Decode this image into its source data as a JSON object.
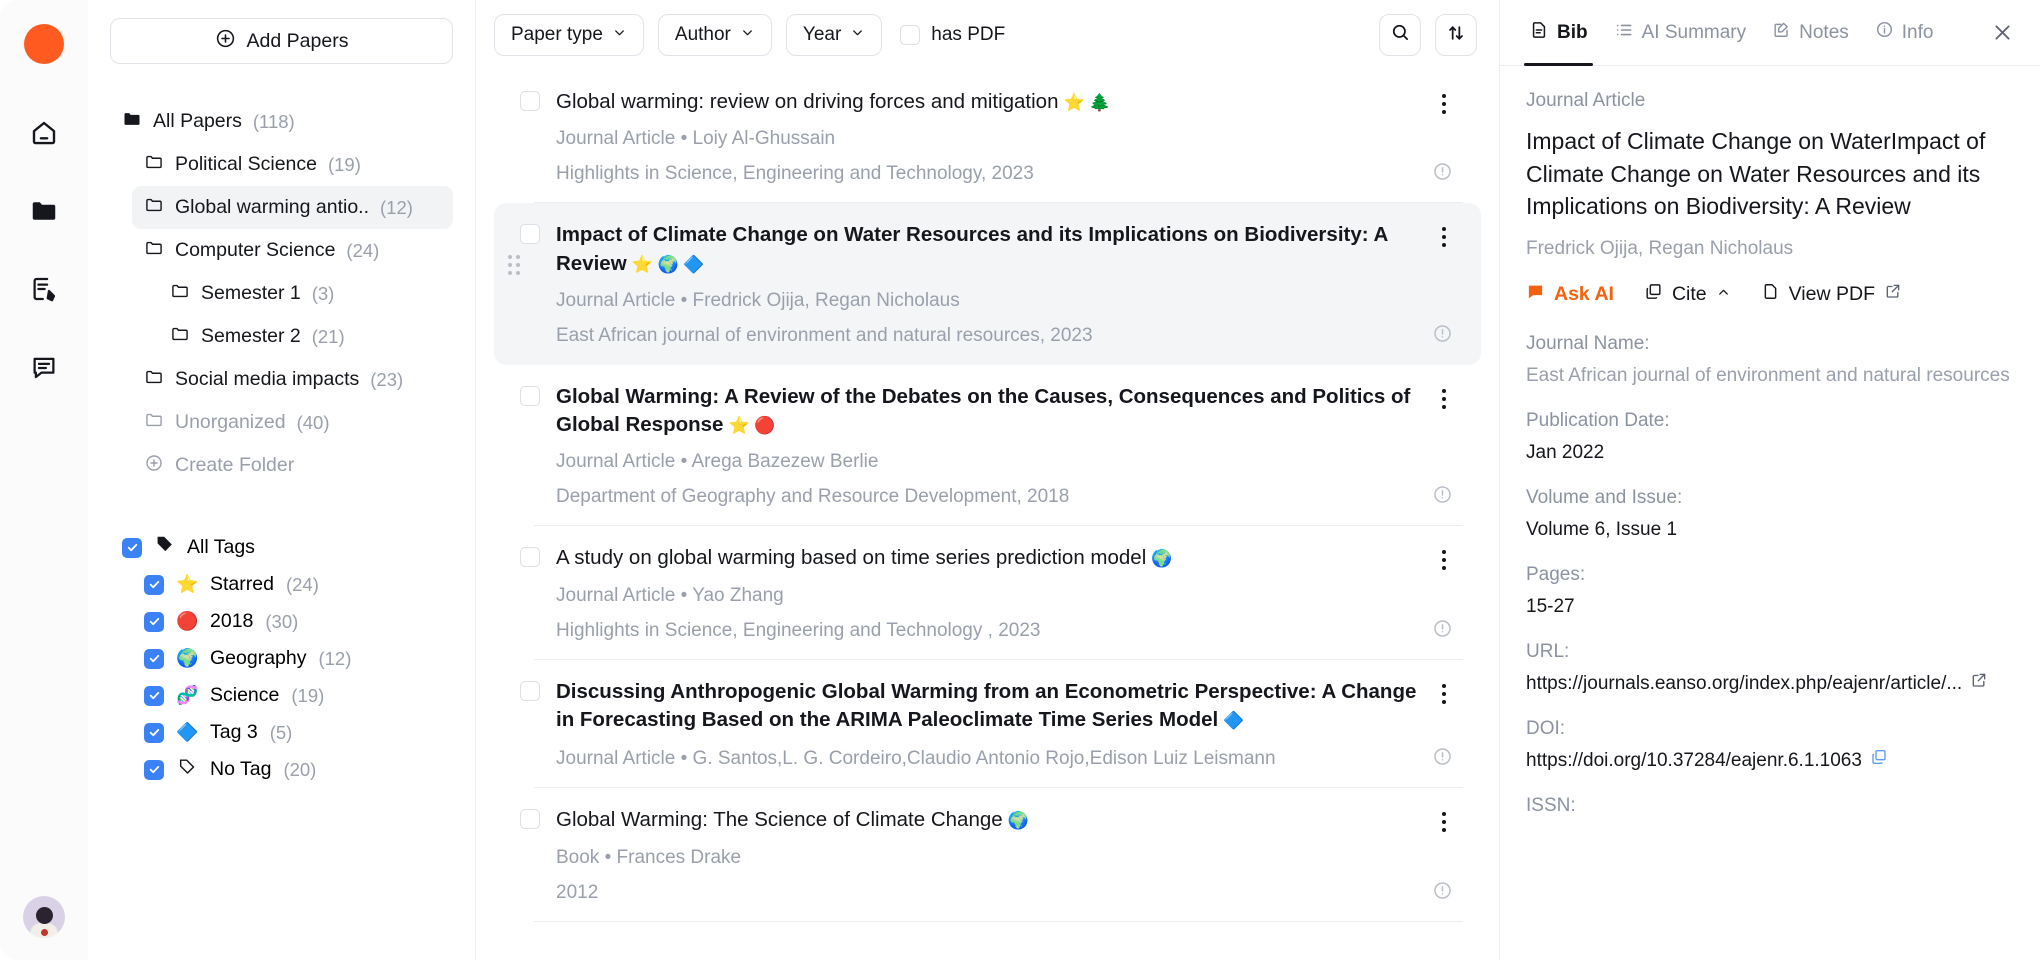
{
  "rail": {
    "logo": "logo-dot",
    "icons": [
      "home-icon",
      "folder-icon",
      "notes-icon",
      "chat-icon"
    ],
    "avatar": "user-avatar"
  },
  "sidebar": {
    "add_papers_label": "Add Papers",
    "folders": [
      {
        "label": "All Papers",
        "count": "(118)",
        "indent": 0,
        "active": false,
        "filled": true
      },
      {
        "label": "Political Science",
        "count": "(19)",
        "indent": 1,
        "active": false,
        "filled": false
      },
      {
        "label": "Global warming antio..",
        "count": "(12)",
        "indent": 1,
        "active": true,
        "filled": false
      },
      {
        "label": "Computer Science",
        "count": "(24)",
        "indent": 1,
        "active": false,
        "filled": false
      },
      {
        "label": "Semester 1",
        "count": "(3)",
        "indent": 2,
        "active": false,
        "filled": false
      },
      {
        "label": "Semester 2",
        "count": "(21)",
        "indent": 2,
        "active": false,
        "filled": false
      },
      {
        "label": "Social media impacts",
        "count": "(23)",
        "indent": 1,
        "active": false,
        "filled": false
      },
      {
        "label": "Unorganized",
        "count": "(40)",
        "indent": 1,
        "active": false,
        "filled": false
      }
    ],
    "create_folder_label": "Create Folder",
    "all_tags_label": "All Tags",
    "tags": [
      {
        "emoji": "⭐",
        "label": "Starred",
        "count": "(24)",
        "checked": true
      },
      {
        "emoji": "🔴",
        "label": "2018",
        "count": "(30)",
        "checked": true
      },
      {
        "emoji": "🌍",
        "label": "Geography",
        "count": "(12)",
        "checked": true
      },
      {
        "emoji": "🧬",
        "label": "Science",
        "count": "(19)",
        "checked": true
      },
      {
        "emoji": "🔷",
        "label": "Tag 3",
        "count": "(5)",
        "checked": true
      },
      {
        "emoji": "🏷️",
        "label": "No Tag",
        "count": "(20)",
        "checked": true
      }
    ]
  },
  "toolbar": {
    "filters": [
      {
        "label": "Paper type",
        "icon": "chevron-down-icon"
      },
      {
        "label": "Author",
        "icon": "chevron-down-icon"
      },
      {
        "label": "Year",
        "icon": "chevron-down-icon"
      }
    ],
    "has_pdf_label": "has PDF",
    "has_pdf_checked": false,
    "search_icon": "search-icon",
    "sort_icon": "sort-icon"
  },
  "papers": [
    {
      "title": "Global warming: review on driving forces and mitigation",
      "tags": "⭐ 🌲",
      "meta": "Journal Article • Loiy Al-Ghussain",
      "source": "Highlights in Science, Engineering and Technology, 2023",
      "selected": false,
      "bold": false
    },
    {
      "title": "Impact of Climate Change on Water Resources and its Implications on Biodiversity: A Review",
      "tags": "⭐ 🌍 🔷",
      "meta": "Journal Article • Fredrick Ojija, Regan Nicholaus",
      "source": "East African journal of environment and natural resources, 2023",
      "selected": true,
      "bold": true
    },
    {
      "title": "Global Warming: A Review of the Debates on the Causes, Consequences and Politics of Global Response",
      "tags": "⭐ 🔴",
      "meta": "Journal Article • Arega Bazezew Berlie",
      "source": "Department of Geography and Resource Development, 2018",
      "selected": false,
      "bold": true
    },
    {
      "title": "A study on global warming based on time series prediction model",
      "tags": "🌍",
      "meta": "Journal Article • Yao Zhang",
      "source": "Highlights in Science, Engineering and Technology , 2023",
      "selected": false,
      "bold": false
    },
    {
      "title": "Discussing Anthropogenic Global Warming from an Econometric Perspective: A Change in Forecasting Based on the ARIMA Paleoclimate Time Series Model",
      "tags": "🔷",
      "meta": "Journal Article • G. Santos,L. G. Cordeiro,Claudio Antonio Rojo,Edison Luiz Leismann",
      "source": "",
      "selected": false,
      "bold": true
    },
    {
      "title": "Global Warming: The Science of Climate Change",
      "tags": "🌍",
      "meta": "Book • Frances Drake",
      "source": "2012",
      "selected": false,
      "bold": false
    }
  ],
  "right_panel": {
    "tabs": [
      {
        "label": "Bib",
        "icon": "document-icon",
        "active": true
      },
      {
        "label": "AI Summary",
        "icon": "list-icon",
        "active": false
      },
      {
        "label": "Notes",
        "icon": "edit-icon",
        "active": false
      },
      {
        "label": "Info",
        "icon": "info-icon",
        "active": false
      }
    ],
    "close_icon": "close-icon",
    "kind": "Journal Article",
    "title": "Impact of Climate Change on WaterImpact of Climate Change on Water Resources and its Implications on Biodiversity:  A Review",
    "authors": "Fredrick Ojija, Regan Nicholaus",
    "actions": {
      "ask_ai": "Ask AI",
      "cite": "Cite",
      "view_pdf": "View PDF"
    },
    "fields": [
      {
        "label": "Journal Name:",
        "value": "East African journal of environment and natural resources",
        "muted": true,
        "icon": ""
      },
      {
        "label": "Publication Date:",
        "value": "Jan 2022",
        "muted": false,
        "icon": ""
      },
      {
        "label": "Volume and Issue:",
        "value": "Volume 6, Issue 1",
        "muted": false,
        "icon": ""
      },
      {
        "label": "Pages:",
        "value": "15-27",
        "muted": false,
        "icon": ""
      },
      {
        "label": "URL:",
        "value": "https://journals.eanso.org/index.php/eajenr/article/...",
        "muted": false,
        "icon": "external-link-icon"
      },
      {
        "label": "DOI:",
        "value": "https://doi.org/10.37284/eajenr.6.1.1063",
        "muted": false,
        "icon": "copy-icon"
      },
      {
        "label": "ISSN:",
        "value": "",
        "muted": false,
        "icon": ""
      }
    ]
  },
  "colors": {
    "brand": "#FF5A1F",
    "accent": "#F4620E",
    "checkbox": "#3b82f6",
    "text": "#15171c",
    "muted": "#9aa0ab"
  }
}
